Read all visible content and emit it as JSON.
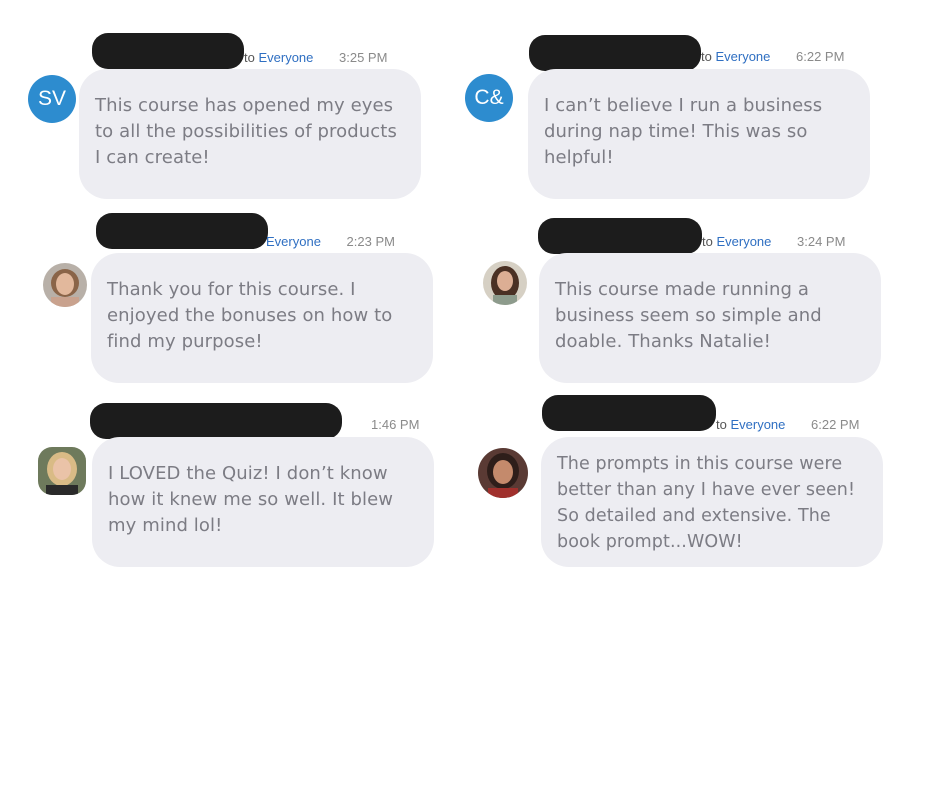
{
  "messages": [
    {
      "avatar": "SV",
      "to": "to",
      "recipient": "Everyone",
      "time": "3:25 PM",
      "text": "This course has opened my eyes to all the possibilities of products I can create!"
    },
    {
      "avatar": "C&",
      "to": "to",
      "recipient": "Everyone",
      "time": "6:22 PM",
      "text": "I can’t believe I run a business during nap time! This was so helpful!"
    },
    {
      "avatar": "",
      "to": "",
      "recipient": "Everyone",
      "time": "2:23 PM",
      "text": "Thank you for this course. I enjoyed the bonuses on how to find my purpose!"
    },
    {
      "avatar": "",
      "to": "to",
      "recipient": "Everyone",
      "time": "3:24 PM",
      "text": "This course made running a business seem so simple and doable. Thanks Natalie!"
    },
    {
      "avatar": "",
      "to": "",
      "recipient": "",
      "time": "1:46 PM",
      "text": "I LOVED the Quiz! I don’t know how it knew me so well. It blew my mind lol!"
    },
    {
      "avatar": "",
      "to": "to",
      "recipient": "Everyone",
      "time": "6:22 PM",
      "text": "The prompts in this course were better than any I have ever seen! So detailed and extensive. The book prompt...WOW!"
    }
  ]
}
